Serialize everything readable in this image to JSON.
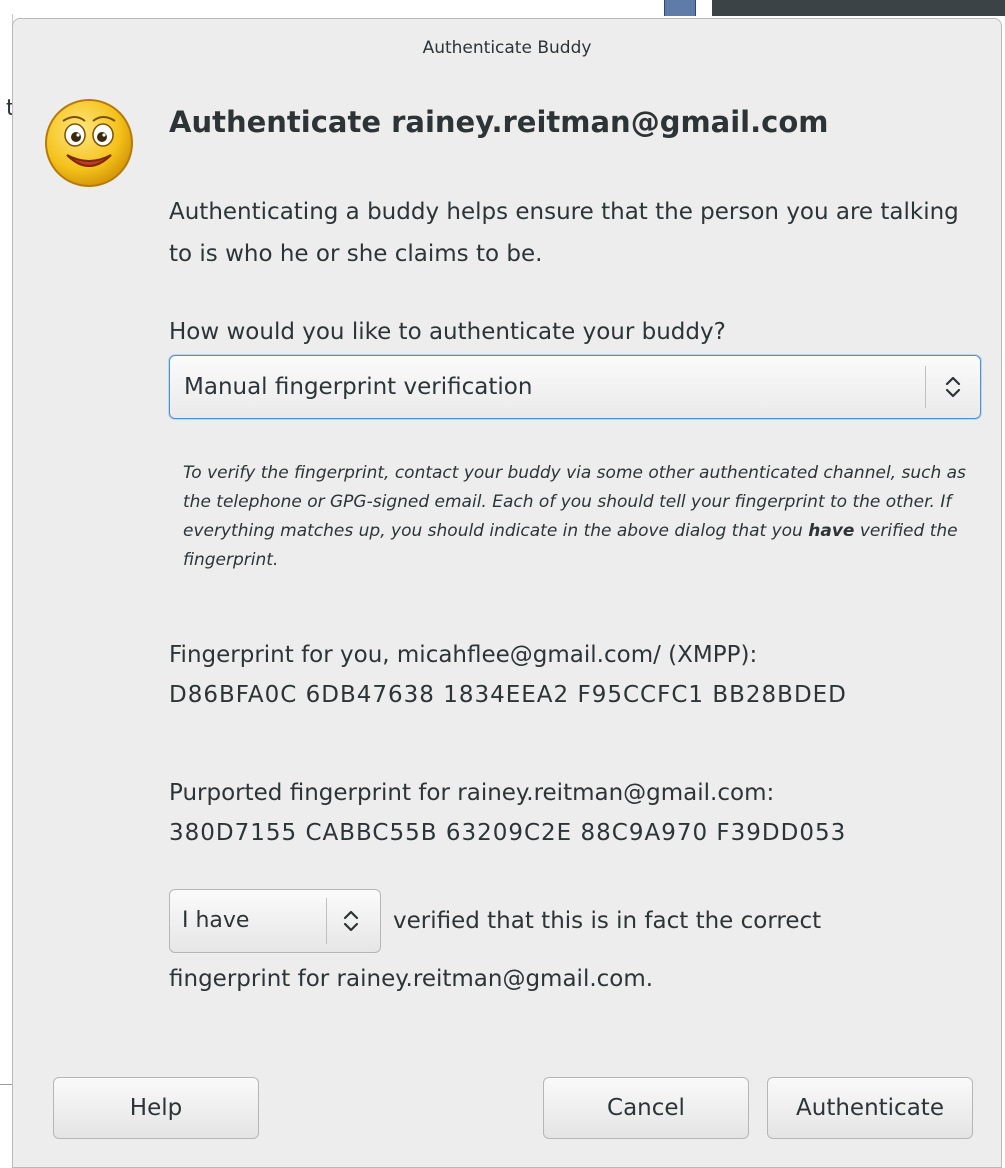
{
  "window": {
    "title": "Authenticate Buddy",
    "background_char": "t"
  },
  "icon": "smiley-face-icon",
  "heading": "Authenticate rainey.reitman@gmail.com",
  "intro": "Authenticating a buddy helps ensure that the person you are talking to is who he or she claims to be.",
  "question": "How would you like to authenticate your buddy?",
  "method_select": {
    "value": "Manual fingerprint verification",
    "icon": "updown-arrows-icon"
  },
  "note": {
    "part1": "To verify the fingerprint, contact your buddy via some other authenticated channel, such as the telephone or GPG-signed email.  Each of you should tell your fingerprint to the other. If everything matches up, you should indicate in the above dialog that you ",
    "bold": "have",
    "part2": " verified the fingerprint."
  },
  "my_fingerprint": {
    "label": "Fingerprint for you, micahflee@gmail.com/ (XMPP):",
    "value": "D86BFA0C 6DB47638 1834EEA2 F95CCFC1 BB28BDED"
  },
  "their_fingerprint": {
    "label": "Purported fingerprint for rainey.reitman@gmail.com:",
    "value": "380D7155 CABBC55B 63209C2E 88C9A970 F39DD053"
  },
  "verify": {
    "select_value": "I have",
    "text_line1": "verified that this is in fact the correct",
    "text_line2": "fingerprint for rainey.reitman@gmail.com."
  },
  "buttons": {
    "help": "Help",
    "cancel": "Cancel",
    "authenticate": "Authenticate"
  },
  "colors": {
    "dialog_bg": "#ededed",
    "focus_border": "#4a90d9",
    "text": "#2e3436"
  }
}
